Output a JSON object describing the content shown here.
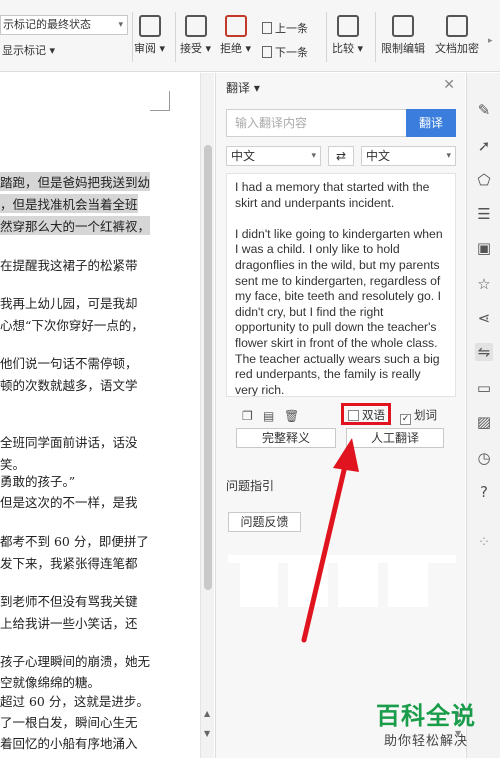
{
  "ribbon": {
    "markup_state_select": "示标记的最终状态",
    "show_markup": "显示标记",
    "review": "审阅",
    "accept": "接受",
    "reject": "拒绝",
    "previous": "上一条",
    "next": "下一条",
    "compare": "比较",
    "restrict_editing": "限制编辑",
    "doc_encrypt": "文档加密"
  },
  "document": {
    "lines": [
      "踏跑，但是爸妈把我送到幼",
      "，但是找准机会当着全班",
      "然穿那么大的一个红裤衩，",
      "在提醒我这裙子的松紧带",
      "我再上幼儿园，可是我却",
      "心想“下次你穿好一点的，",
      "    他们说一句话不需停顿，",
      "顿的次数就越多，语文学",
      "全班同学面前讲话，话没",
      "笑。",
      "勇敢的孩子。”",
      "但是这次的不一样，是我",
      "都考不到 60 分，即便拼了",
      "发下来，我紧张得连笔都",
      "到老师不但没有骂我关键",
      "上给我讲一些小笑话，还",
      "孩子心理瞬间的崩溃，她无",
      "空就像绵绵的糖。",
      "超过 60 分，这就是进步。",
      "了一根白发，瞬间心生无",
      "着回忆的小船有序地涌入"
    ]
  },
  "panel": {
    "title": "翻译",
    "search_placeholder": "输入翻译内容",
    "translate_button": "翻译",
    "source_lang": "中文",
    "target_lang": "中文",
    "result": [
      "I had a memory that started with the skirt and underpants incident.",
      "I didn't like going to kindergarten when I was a child. I only like to hold dragonflies in the wild, but my parents sent me to kindergarten, regardless of my face, bite teeth and resolutely go. I didn't cry, but I find the right opportunity to pull down the teacher's flower skirt in front of the whole class. The teacher actually wears such a big red underpants, the family is really very rich."
    ],
    "bilingual_label": "双语",
    "word_pick_label": "划词",
    "full_definition_button": "完整释义",
    "human_translation_button": "人工翻译",
    "help_section_title": "问题指引",
    "feedback_button": "问题反馈"
  },
  "watermark": {
    "brand": "百科全说",
    "slogan": "助你轻松解决"
  },
  "colors": {
    "accent": "#3a7ddc",
    "annotation": "#e0141e",
    "brand_green": "#1a9d4a"
  }
}
